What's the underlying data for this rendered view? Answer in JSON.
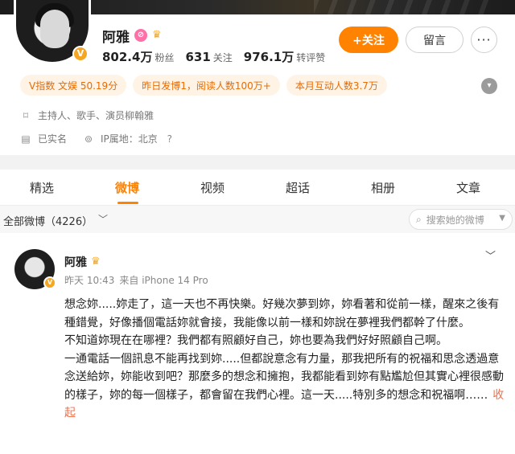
{
  "profile": {
    "name": "阿雅",
    "stats": [
      {
        "num": "802.4万",
        "label": "粉丝"
      },
      {
        "num": "631",
        "label": "关注"
      },
      {
        "num": "976.1万",
        "label": "转评赞"
      }
    ],
    "follow_label": "+关注",
    "message_label": "留言",
    "more_label": "···",
    "tags": [
      "V指数 文娱 50.19分",
      "昨日发博1，阅读人数100万+",
      "本月互动人数3.7万"
    ],
    "bio": "主持人、歌手、演员柳翰雅",
    "verified": "已实名",
    "ip_location": "IP属地：北京"
  },
  "tabs": [
    "精选",
    "微博",
    "视频",
    "超话",
    "相册",
    "文章"
  ],
  "active_tab": "微博",
  "filter": {
    "label": "全部微博（4226）",
    "search_placeholder": "搜索她的微博"
  },
  "post": {
    "author": "阿雅",
    "time": "昨天 10:43",
    "source": "来自 iPhone 14 Pro",
    "paragraphs": [
      "想念妳.....妳走了，這一天也不再快樂。好幾次夢到妳，妳看著和從前一樣，醒來之後有種錯覺，好像播個電話妳就會接，我能像以前一樣和妳說在夢裡我們都幹了什麼。",
      "不知道妳現在在哪裡？我們都有照顧好自己，妳也要為我們好好照顧自己啊。",
      "一通電話一個訊息不能再找到妳.....但都說意念有力量，那我把所有的祝福和思念透過意念送給妳，妳能收到吧？那麼多的想念和擁抱，我都能看到妳有點尷尬但其實心裡很感動的樣子，妳的每一個樣子，都會留在我們心裡。這一天.....特別多的想念和祝福啊……"
    ],
    "collapse_label": "收起"
  }
}
